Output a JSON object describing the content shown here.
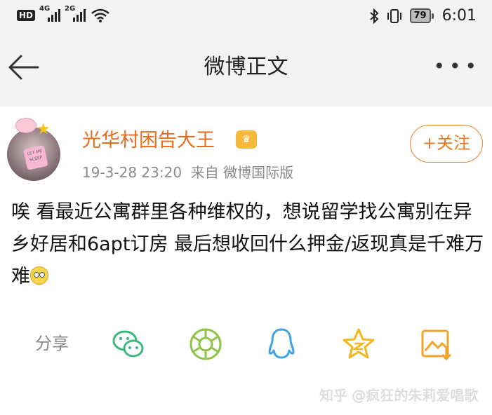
{
  "status_bar": {
    "hd": "HD",
    "net1": "4G",
    "net2": "2G",
    "battery": "79",
    "time": "6:01"
  },
  "nav": {
    "title": "微博正文",
    "more": "•••"
  },
  "post": {
    "username": "光华村困告大王",
    "timestamp": "19-3-28 23:20",
    "source": "来自 微博国际版",
    "follow_label": "+关注",
    "text": "唉 看最近公寓群里各种维权的，想说留学找公寓别在异乡好居和6apt订房 最后想收回什么押金/返现真是千难万难",
    "sticker_text": "LET ME SLEEP"
  },
  "share": {
    "label": "分享",
    "targets": [
      "wechat-icon",
      "moments-icon",
      "qq-icon",
      "qzone-icon",
      "share-image-icon"
    ]
  },
  "watermark": "知乎 @疯狂的朱莉爱唱歌",
  "colors": {
    "accent": "#ee7a23",
    "wechat": "#3bb97c",
    "moments": "#8fc34a",
    "qq": "#3aa3e3",
    "qzone": "#f5b51c"
  }
}
